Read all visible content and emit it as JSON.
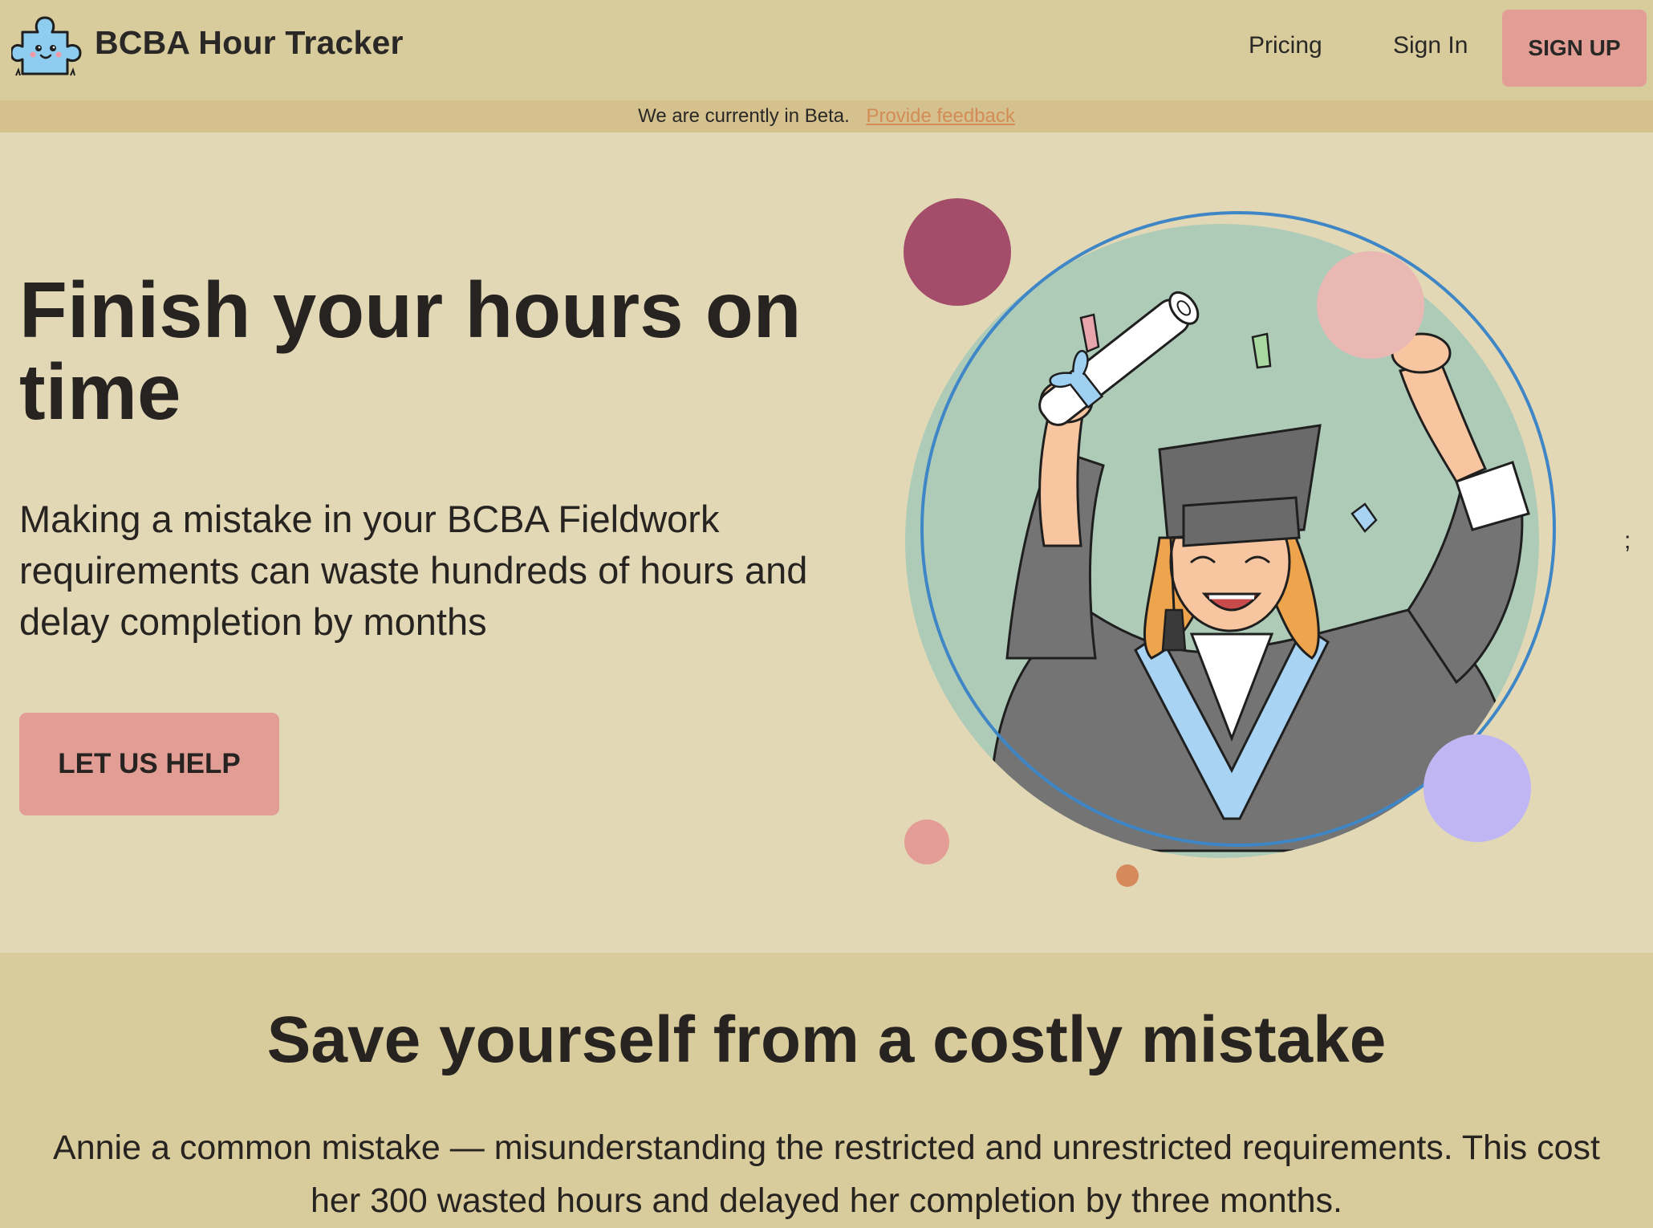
{
  "header": {
    "brand": "BCBA Hour Tracker",
    "logo_icon": "puzzle-piece-mascot-icon",
    "nav": {
      "pricing": "Pricing",
      "sign_in": "Sign In",
      "sign_up": "SIGN UP"
    }
  },
  "beta_banner": {
    "text": "We are currently in Beta.",
    "link": "Provide feedback"
  },
  "hero": {
    "title": "Finish your hours on time",
    "subtitle": "Making a mistake in your BCBA Fieldwork requirements can waste hundreds of hours and delay completion by months",
    "cta": "LET US HELP",
    "stray_char": ";",
    "illustration": "graduate-celebrating-illustration"
  },
  "section_mistake": {
    "title": "Save yourself from a costly mistake",
    "text": "Annie a common mistake — misunderstanding the restricted and unrestricted requirements. This cost her 300 wasted hours and delayed her completion by three months."
  },
  "colors": {
    "header_bg": "#d8cb9c",
    "beta_bg": "#d4c18e",
    "page_bg": "#e2d8b6",
    "button": "#e29e95",
    "link": "#d58b55",
    "circle_mint": "#aecbb8",
    "ring_blue": "#3f86c6",
    "dot_maroon": "#a34d6b",
    "dot_pink": "#e9b8b3",
    "dot_lavender": "#c0b6f3",
    "dot_coral": "#e39d96",
    "dot_orange": "#d6895a"
  }
}
